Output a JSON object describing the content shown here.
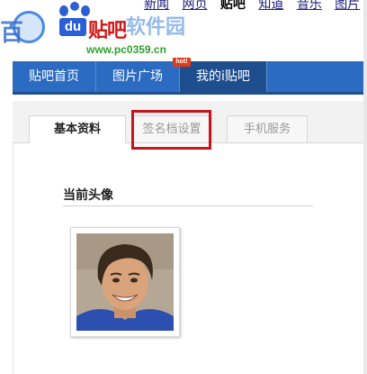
{
  "header": {
    "top_links": [
      "新闻",
      "网页",
      "贴吧",
      "知道",
      "音乐",
      "图片"
    ],
    "logo_du": "du",
    "logo_tieba": "贴吧",
    "watermark_text": "软件园",
    "watermark_url": "www.pc0359.cn",
    "watermark_left_char": "百"
  },
  "nav": {
    "items": [
      {
        "label": "贴吧首页"
      },
      {
        "label": "图片广场"
      },
      {
        "label": "我的i贴吧"
      }
    ],
    "hot_badge": "hot!"
  },
  "tabs": [
    {
      "label": "基本资料",
      "active": true
    },
    {
      "label": "签名档设置",
      "active": false,
      "highlighted": true
    },
    {
      "label": "手机服务",
      "active": false
    }
  ],
  "main": {
    "section_title": "当前头像"
  },
  "colors": {
    "nav_blue": "#2b6bc1",
    "highlight_red": "#c4161c",
    "tieba_red": "#d01818"
  }
}
